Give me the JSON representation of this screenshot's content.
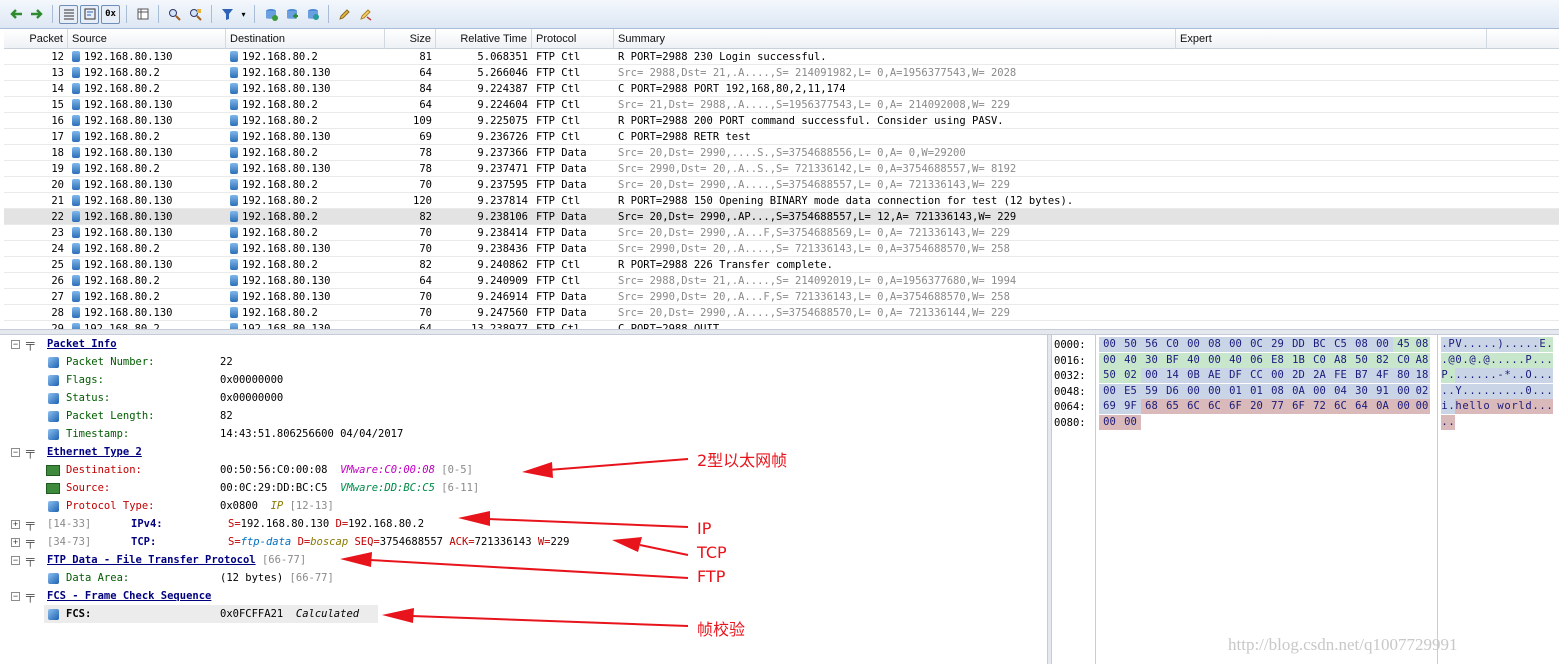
{
  "toolbar": {
    "buttons": [
      "back-icon",
      "forward-icon",
      "list-view-icon",
      "detail-view-icon",
      "hex-view-icon",
      "columns-icon",
      "search-icon",
      "find-next-icon",
      "filter-icon",
      "add-filter-icon",
      "refresh-icon",
      "save-icon",
      "edit-icon",
      "clear-icon"
    ],
    "hex_label": "0x"
  },
  "packet_list": {
    "columns": [
      "Packet",
      "Source",
      "Destination",
      "Size",
      "Relative Time",
      "Protocol",
      "Summary",
      "Expert"
    ],
    "rows": [
      {
        "no": "12",
        "src": "192.168.80.130",
        "dst": "192.168.80.2",
        "size": "81",
        "time": "5.068351",
        "proto": "FTP Ctl",
        "summary": "R PORT=2988 230 Login successful.",
        "grey": false
      },
      {
        "no": "13",
        "src": "192.168.80.2",
        "dst": "192.168.80.130",
        "size": "64",
        "time": "5.266046",
        "proto": "FTP Ctl",
        "summary": "Src= 2988,Dst=   21,.A....,S= 214091982,L=    0,A=1956377543,W= 2028",
        "grey": true
      },
      {
        "no": "14",
        "src": "192.168.80.2",
        "dst": "192.168.80.130",
        "size": "84",
        "time": "9.224387",
        "proto": "FTP Ctl",
        "summary": "C PORT=2988 PORT 192,168,80,2,11,174",
        "grey": false
      },
      {
        "no": "15",
        "src": "192.168.80.130",
        "dst": "192.168.80.2",
        "size": "64",
        "time": "9.224604",
        "proto": "FTP Ctl",
        "summary": "Src=   21,Dst= 2988,.A....,S=1956377543,L=    0,A= 214092008,W=  229",
        "grey": true
      },
      {
        "no": "16",
        "src": "192.168.80.130",
        "dst": "192.168.80.2",
        "size": "109",
        "time": "9.225075",
        "proto": "FTP Ctl",
        "summary": "R PORT=2988 200 PORT command successful. Consider using PASV.",
        "grey": false
      },
      {
        "no": "17",
        "src": "192.168.80.2",
        "dst": "192.168.80.130",
        "size": "69",
        "time": "9.236726",
        "proto": "FTP Ctl",
        "summary": "C PORT=2988 RETR test",
        "grey": false
      },
      {
        "no": "18",
        "src": "192.168.80.130",
        "dst": "192.168.80.2",
        "size": "78",
        "time": "9.237366",
        "proto": "FTP Data",
        "summary": "Src=   20,Dst= 2990,....S.,S=3754688556,L=    0,A=         0,W=29200",
        "grey": true
      },
      {
        "no": "19",
        "src": "192.168.80.2",
        "dst": "192.168.80.130",
        "size": "78",
        "time": "9.237471",
        "proto": "FTP Data",
        "summary": "Src= 2990,Dst=   20,.A..S.,S= 721336142,L=    0,A=3754688557,W= 8192",
        "grey": true
      },
      {
        "no": "20",
        "src": "192.168.80.130",
        "dst": "192.168.80.2",
        "size": "70",
        "time": "9.237595",
        "proto": "FTP Data",
        "summary": "Src=   20,Dst= 2990,.A....,S=3754688557,L=    0,A= 721336143,W=  229",
        "grey": true
      },
      {
        "no": "21",
        "src": "192.168.80.130",
        "dst": "192.168.80.2",
        "size": "120",
        "time": "9.237814",
        "proto": "FTP Ctl",
        "summary": "R PORT=2988 150 Opening BINARY mode data connection for test (12 bytes).",
        "grey": false
      },
      {
        "no": "22",
        "src": "192.168.80.130",
        "dst": "192.168.80.2",
        "size": "82",
        "time": "9.238106",
        "proto": "FTP Data",
        "summary": "Src=   20,Dst= 2990,.AP...,S=3754688557,L=   12,A= 721336143,W=  229",
        "grey": false,
        "selected": true
      },
      {
        "no": "23",
        "src": "192.168.80.130",
        "dst": "192.168.80.2",
        "size": "70",
        "time": "9.238414",
        "proto": "FTP Data",
        "summary": "Src=   20,Dst= 2990,.A...F,S=3754688569,L=    0,A= 721336143,W=  229",
        "grey": true
      },
      {
        "no": "24",
        "src": "192.168.80.2",
        "dst": "192.168.80.130",
        "size": "70",
        "time": "9.238436",
        "proto": "FTP Data",
        "summary": "Src= 2990,Dst=   20,.A....,S= 721336143,L=    0,A=3754688570,W=  258",
        "grey": true
      },
      {
        "no": "25",
        "src": "192.168.80.130",
        "dst": "192.168.80.2",
        "size": "82",
        "time": "9.240862",
        "proto": "FTP Ctl",
        "summary": "R PORT=2988 226 Transfer complete.",
        "grey": false
      },
      {
        "no": "26",
        "src": "192.168.80.2",
        "dst": "192.168.80.130",
        "size": "64",
        "time": "9.240909",
        "proto": "FTP Ctl",
        "summary": "Src= 2988,Dst=   21,.A....,S= 214092019,L=    0,A=1956377680,W= 1994",
        "grey": true
      },
      {
        "no": "27",
        "src": "192.168.80.2",
        "dst": "192.168.80.130",
        "size": "70",
        "time": "9.246914",
        "proto": "FTP Data",
        "summary": "Src= 2990,Dst=   20,.A...F,S= 721336143,L=    0,A=3754688570,W=  258",
        "grey": true
      },
      {
        "no": "28",
        "src": "192.168.80.130",
        "dst": "192.168.80.2",
        "size": "70",
        "time": "9.247560",
        "proto": "FTP Data",
        "summary": "Src=   20,Dst= 2990,.A....,S=3754688570,L=    0,A= 721336144,W=  229",
        "grey": true
      },
      {
        "no": "29",
        "src": "192.168.80.2",
        "dst": "192.168.80.130",
        "size": "64",
        "time": "13.238977",
        "proto": "FTP Ctl",
        "summary": "C PORT=2988 QUIT",
        "grey": false
      }
    ]
  },
  "details": {
    "packet_info": {
      "title": "Packet Info",
      "fields": [
        {
          "name": "Packet Number:",
          "value": "22"
        },
        {
          "name": "Flags:",
          "value": "0x00000000"
        },
        {
          "name": "Status:",
          "value": "0x00000000"
        },
        {
          "name": "Packet Length:",
          "value": "82"
        },
        {
          "name": "Timestamp:",
          "value": "14:43:51.806256600 04/04/2017"
        }
      ]
    },
    "ethernet": {
      "title": "Ethernet Type 2",
      "destination": {
        "name": "Destination:",
        "value": "00:50:56:C0:00:08",
        "vendor": "VMware:C0:00:08",
        "range": "[0-5]"
      },
      "source": {
        "name": "Source:",
        "value": "00:0C:29:DD:BC:C5",
        "vendor": "VMware:DD:BC:C5",
        "range": "[6-11]"
      },
      "protocol_type": {
        "name": "Protocol Type:",
        "value": "0x0800",
        "proto": "IP",
        "range": "[12-13]"
      }
    },
    "ipv4": {
      "range": "[14-33]",
      "name": "IPv4:",
      "s_label": "S=",
      "s_val": "192.168.80.130",
      "d_label": "D=",
      "d_val": "192.168.80.2"
    },
    "tcp": {
      "range": "[34-73]",
      "name": "TCP:",
      "s_label": "S=",
      "s_val": "ftp-data",
      "d_label": "D=",
      "d_val": "boscap",
      "seq_label": "SEQ=",
      "seq_val": "3754688557",
      "ack_label": "ACK=",
      "ack_val": "721336143",
      "w_label": "W=",
      "w_val": "229"
    },
    "ftp_data": {
      "title": "FTP Data - File Transfer Protocol",
      "range": "[66-77]",
      "field_name": "Data Area:",
      "field_value": "(12 bytes)",
      "field_range": "[66-77]"
    },
    "fcs": {
      "title": "FCS - Frame Check Sequence",
      "field_name": "FCS:",
      "field_value": "0x0FCFFA21",
      "field_note": "Calculated"
    }
  },
  "hex": {
    "offsets": [
      "0000:",
      "0016:",
      "0032:",
      "0048:",
      "0064:",
      "0080:"
    ],
    "rows": [
      [
        "00",
        "50",
        "56",
        "C0",
        "00",
        "08",
        "00",
        "0C",
        "29",
        "DD",
        "BC",
        "C5",
        "08",
        "00",
        "45",
        "08"
      ],
      [
        "00",
        "40",
        "30",
        "BF",
        "40",
        "00",
        "40",
        "06",
        "E8",
        "1B",
        "C0",
        "A8",
        "50",
        "82",
        "C0",
        "A8"
      ],
      [
        "50",
        "02",
        "00",
        "14",
        "0B",
        "AE",
        "DF",
        "CC",
        "00",
        "2D",
        "2A",
        "FE",
        "B7",
        "4F",
        "80",
        "18"
      ],
      [
        "00",
        "E5",
        "59",
        "D6",
        "00",
        "00",
        "01",
        "01",
        "08",
        "0A",
        "00",
        "04",
        "30",
        "91",
        "00",
        "02"
      ],
      [
        "69",
        "9F",
        "68",
        "65",
        "6C",
        "6C",
        "6F",
        "20",
        "77",
        "6F",
        "72",
        "6C",
        "64",
        "0A",
        "00",
        "00"
      ],
      [
        "00",
        "00"
      ]
    ],
    "ascii": [
      ".PV.....).....E.",
      ".@0.@.@.....P...",
      "P.......-*..O...",
      "..Y.........0...",
      "i.hello world...",
      ".."
    ]
  },
  "annotations": {
    "ethernet": "2型以太网帧",
    "ip": "IP",
    "tcp": "TCP",
    "ftp": "FTP",
    "fcs": "帧校验"
  },
  "watermark": "http://blog.csdn.net/q1007729991",
  "colors": {
    "annotation": "#e8141c",
    "selected_row": "#e3e3e3",
    "ip_bytes": "#c8e6cc",
    "tcp_bytes": "#c9d4e7",
    "data_bytes": "#d9b9b9"
  }
}
